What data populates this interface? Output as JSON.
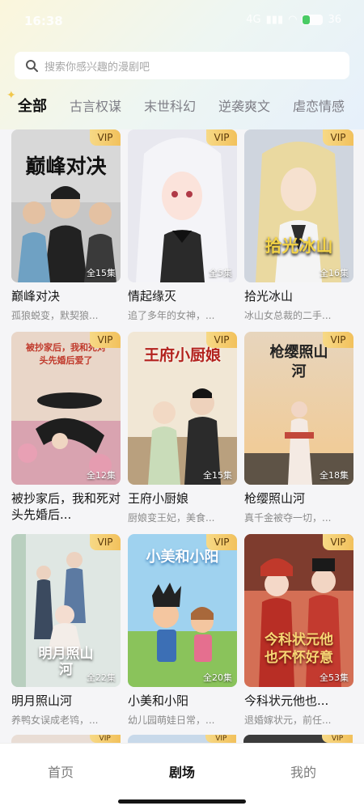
{
  "status_bar": {
    "time": "16:38",
    "network": "4G",
    "battery": "36"
  },
  "search": {
    "placeholder": "搜索你感兴趣的漫剧吧"
  },
  "tabs": [
    {
      "label": "全部",
      "active": true
    },
    {
      "label": "古言权谋"
    },
    {
      "label": "末世科幻"
    },
    {
      "label": "逆袭爽文"
    },
    {
      "label": "虐恋情感"
    }
  ],
  "badge": {
    "vip": "VIP"
  },
  "cards": [
    {
      "title": "巅峰对决",
      "desc": "孤狼蜕变，默契狼...",
      "episodes": "全15集",
      "cover_text": "巅峰对决"
    },
    {
      "title": "情起缘灭",
      "desc": "追了多年的女神，...",
      "episodes": "全5集"
    },
    {
      "title": "拾光冰山",
      "desc": "冰山女总裁的二手...",
      "episodes": "全16集",
      "cover_text": "拾光冰山"
    },
    {
      "title": "被抄家后，我和死对头先婚后...",
      "desc": "",
      "episodes": "全12集",
      "cover_text": "被抄家后，我和死对头先婚后爱了"
    },
    {
      "title": "王府小厨娘",
      "desc": "厨娘变王妃，美食...",
      "episodes": "全15集",
      "cover_text": "王府小厨娘"
    },
    {
      "title": "枪缨照山河",
      "desc": "真千金被夺一切，...",
      "episodes": "全18集",
      "cover_text": "枪缨照山河"
    },
    {
      "title": "明月照山河",
      "desc": "养鸭女误成老鸨，...",
      "episodes": "全22集",
      "cover_text": "明月照山河"
    },
    {
      "title": "小美和小阳",
      "desc": "幼儿园萌娃日常，...",
      "episodes": "全20集",
      "cover_text": "小美和小阳"
    },
    {
      "title": "今科状元他也...",
      "desc": "退婚嫁状元，前任...",
      "episodes": "全53集",
      "cover_text": "今科状元他也不怀好意"
    }
  ],
  "bottom_nav": [
    {
      "label": "首页"
    },
    {
      "label": "剧场",
      "active": true
    },
    {
      "label": "我的"
    }
  ]
}
